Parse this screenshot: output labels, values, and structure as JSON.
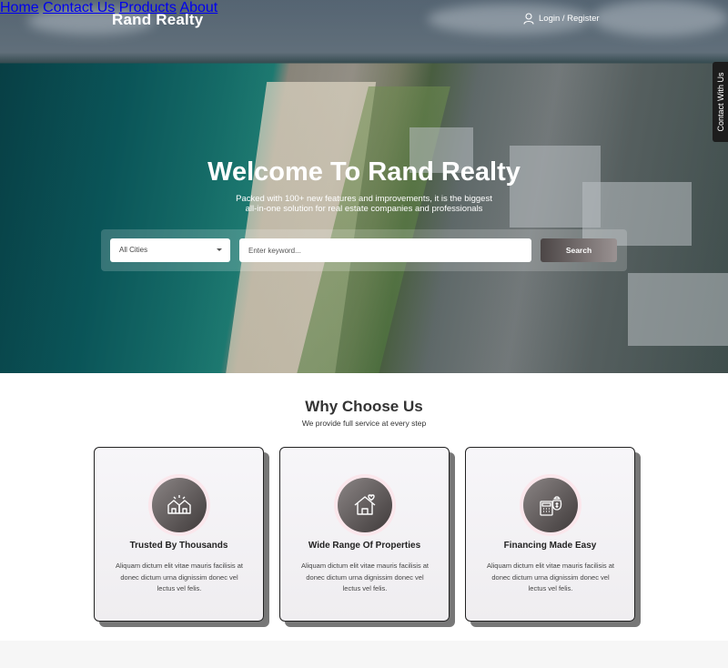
{
  "header": {
    "brand": "Rand Realty",
    "nav": [
      {
        "label": "Home"
      },
      {
        "label": "Contact Us"
      },
      {
        "label": "Products"
      },
      {
        "label": "About"
      }
    ],
    "login_label": "Login / Register",
    "side_tab": "Contact With Us"
  },
  "hero": {
    "title": "Welcome To Rand Realty",
    "subtitle_line1": "Packed with 100+ new features and improvements, it is the biggest",
    "subtitle_line2": "all-in-one solution for real estate companies and professionals",
    "search": {
      "city_value": "All Cities",
      "keyword_placeholder": "Enter keyword...",
      "button_label": "Search"
    }
  },
  "why": {
    "title": "Why Choose Us",
    "subtitle": "We provide full service at every step",
    "cards": [
      {
        "icon": "community-houses-icon",
        "title": "Trusted By Thousands",
        "text": "Aliquam dictum elit vitae mauris facilisis at donec dictum urna dignissim donec vel lectus vel felis."
      },
      {
        "icon": "house-heart-icon",
        "title": "Wide Range Of Properties",
        "text": "Aliquam dictum elit vitae mauris facilisis at donec dictum urna dignissim donec vel lectus vel felis."
      },
      {
        "icon": "money-calculator-icon",
        "title": "Financing Made Easy",
        "text": "Aliquam dictum elit vitae mauris facilisis at donec dictum urna dignissim donec vel lectus vel felis."
      }
    ]
  },
  "colors": {
    "card_border": "#222222",
    "card_shadow": "#777777",
    "icon_halo": "#fbe7ec",
    "search_button_start": "#4c4646",
    "search_button_end": "#9a9292"
  }
}
